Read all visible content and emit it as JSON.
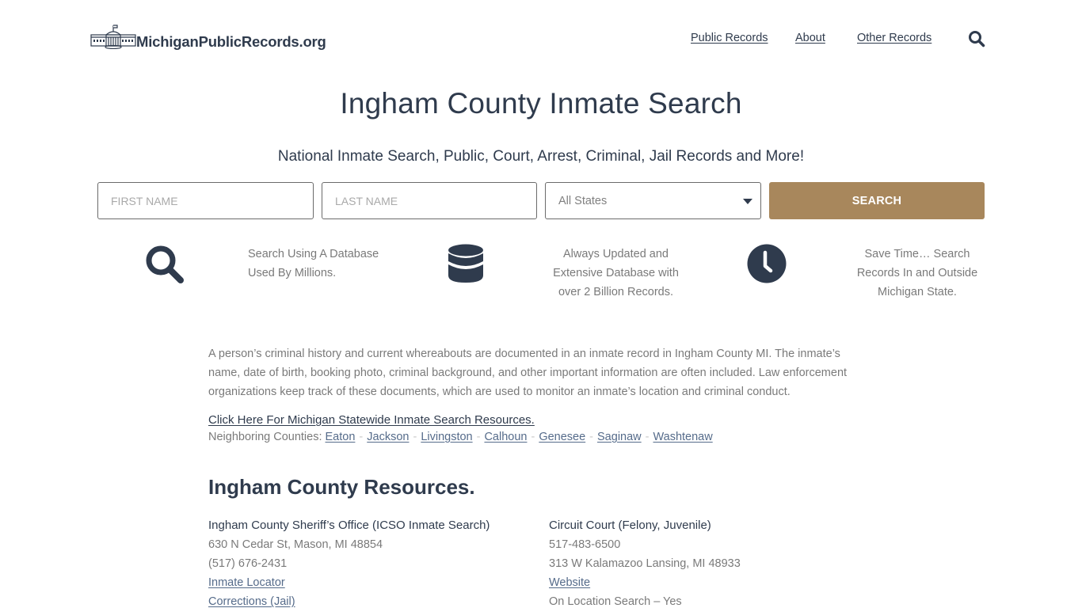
{
  "header": {
    "logo_text": "MichiganPublicRecords.org",
    "logo_icon": "capitol-building-icon",
    "nav": [
      {
        "label": "Public Records"
      },
      {
        "label": "About"
      },
      {
        "label": "Other Records"
      }
    ],
    "search_icon": "search-icon"
  },
  "hero": {
    "title": "Ingham County Inmate Search",
    "subtitle": "National Inmate Search, Public, Court, Arrest, Criminal, Jail Records and More!"
  },
  "search_form": {
    "first_name_placeholder": "FIRST NAME",
    "first_name_value": "",
    "last_name_placeholder": "LAST NAME",
    "last_name_value": "",
    "state_selected": "All States",
    "submit_label": "SEARCH",
    "accent_color": "#a8875c"
  },
  "features": [
    {
      "icon": "search-icon",
      "lines": [
        "Search Using A Database",
        "Used By Millions."
      ]
    },
    {
      "icon": "database-icon",
      "lines": [
        "Always Updated and",
        "Extensive Database with",
        "over 2 Billion Records."
      ]
    },
    {
      "icon": "clock-icon",
      "lines": [
        "Save Time… Search",
        "Records In and Outside",
        "Michigan State."
      ]
    }
  ],
  "content": {
    "intro": "A person’s criminal history and current whereabouts are documented in an inmate record in Ingham County MI. The inmate’s name, date of birth, booking photo, criminal background, and other important information are often included. Law enforcement organizations keep track of these documents, which are used to monitor an inmate’s location and criminal conduct.",
    "statewide_link": "Click Here For Michigan Statewide Inmate Search Resources.",
    "neighbors_label": "Neighboring Counties:",
    "neighbors_separator": "-",
    "neighbors": [
      "Eaton",
      "Jackson",
      "Livingston",
      "Calhoun",
      "Genesee",
      "Saginaw",
      "Washtenaw"
    ]
  },
  "resources": {
    "title": "Ingham County Resources.",
    "sheriff": {
      "name": "Ingham County Sheriff’s Office (ICSO Inmate Search)",
      "address": "630 N Cedar St, Mason, MI 48854",
      "phone": "(517) 676-2431",
      "links": [
        "Inmate Locator",
        "Corrections (Jail)"
      ]
    },
    "court": {
      "name": "Circuit Court (Felony, Juvenile)",
      "phone": "517-483-6500",
      "address": "313 W Kalamazoo Lansing, MI 48933",
      "link": "Website",
      "on_location": "On Location Search – Yes"
    }
  }
}
